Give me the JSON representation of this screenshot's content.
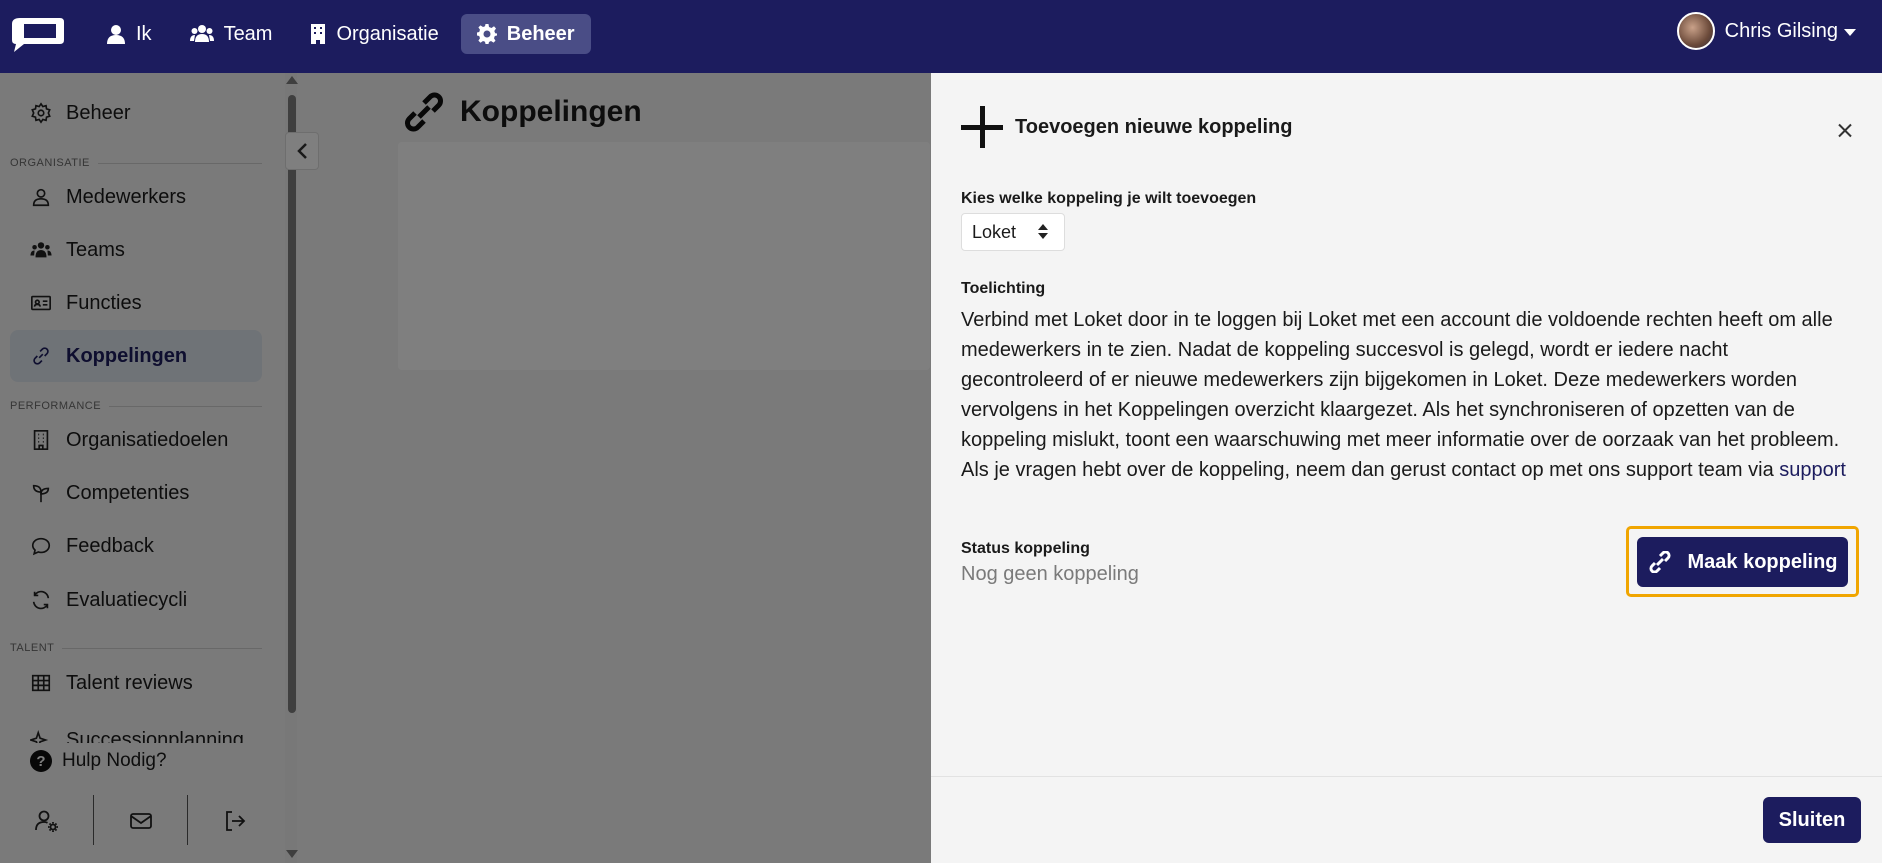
{
  "topnav": {
    "items": [
      {
        "label": "Ik",
        "icon": "user-icon"
      },
      {
        "label": "Team",
        "icon": "users-icon"
      },
      {
        "label": "Organisatie",
        "icon": "building-icon"
      },
      {
        "label": "Beheer",
        "icon": "gear-icon",
        "active": true
      }
    ],
    "user_name": "Chris Gilsing"
  },
  "sidebar": {
    "items": [
      {
        "label": "Beheer",
        "icon": "gear-icon"
      },
      {
        "label": "Medewerkers",
        "icon": "user-icon"
      },
      {
        "label": "Teams",
        "icon": "users-icon"
      },
      {
        "label": "Functies",
        "icon": "id-card-icon"
      },
      {
        "label": "Koppelingen",
        "icon": "link-icon",
        "active": true
      },
      {
        "label": "Organisatiedoelen",
        "icon": "building-icon"
      },
      {
        "label": "Competenties",
        "icon": "sprout-icon"
      },
      {
        "label": "Feedback",
        "icon": "chat-icon"
      },
      {
        "label": "Evaluatiecycli",
        "icon": "refresh-icon"
      },
      {
        "label": "Talent reviews",
        "icon": "grid-icon"
      },
      {
        "label": "Successionplanning",
        "icon": "sparkle-icon"
      }
    ],
    "sections": [
      "ORGANISATIE",
      "PERFORMANCE",
      "TALENT"
    ],
    "help_label": "Hulp Nodig?"
  },
  "main": {
    "title": "Koppelingen"
  },
  "panel": {
    "title": "Toevoegen nieuwe koppeling",
    "select_label": "Kies welke koppeling je wilt toevoegen",
    "select_value": "Loket",
    "desc_label": "Toelichting",
    "description": "Verbind met Loket door in te loggen bij Loket met een account die voldoende rechten heeft om alle medewerkers in te zien. Nadat de koppeling succesvol is gelegd, wordt er iedere nacht gecontroleerd of er nieuwe medewerkers zijn bijgekomen in Loket. Deze medewerkers worden vervolgens in het Koppelingen overzicht klaargezet. Als het synchroniseren of opzetten van de koppeling mislukt, toont een waarschuwing met meer informatie over de oorzaak van het probleem. Als je vragen hebt over de koppeling, neem dan gerust contact op met ons support team via",
    "support_link": "support",
    "status_label": "Status koppeling",
    "status_value": "Nog geen koppeling",
    "connect_button": "Maak koppeling",
    "close_button": "Sluiten"
  },
  "colors": {
    "brand": "#1c1c5e",
    "highlight": "#f0a500"
  }
}
